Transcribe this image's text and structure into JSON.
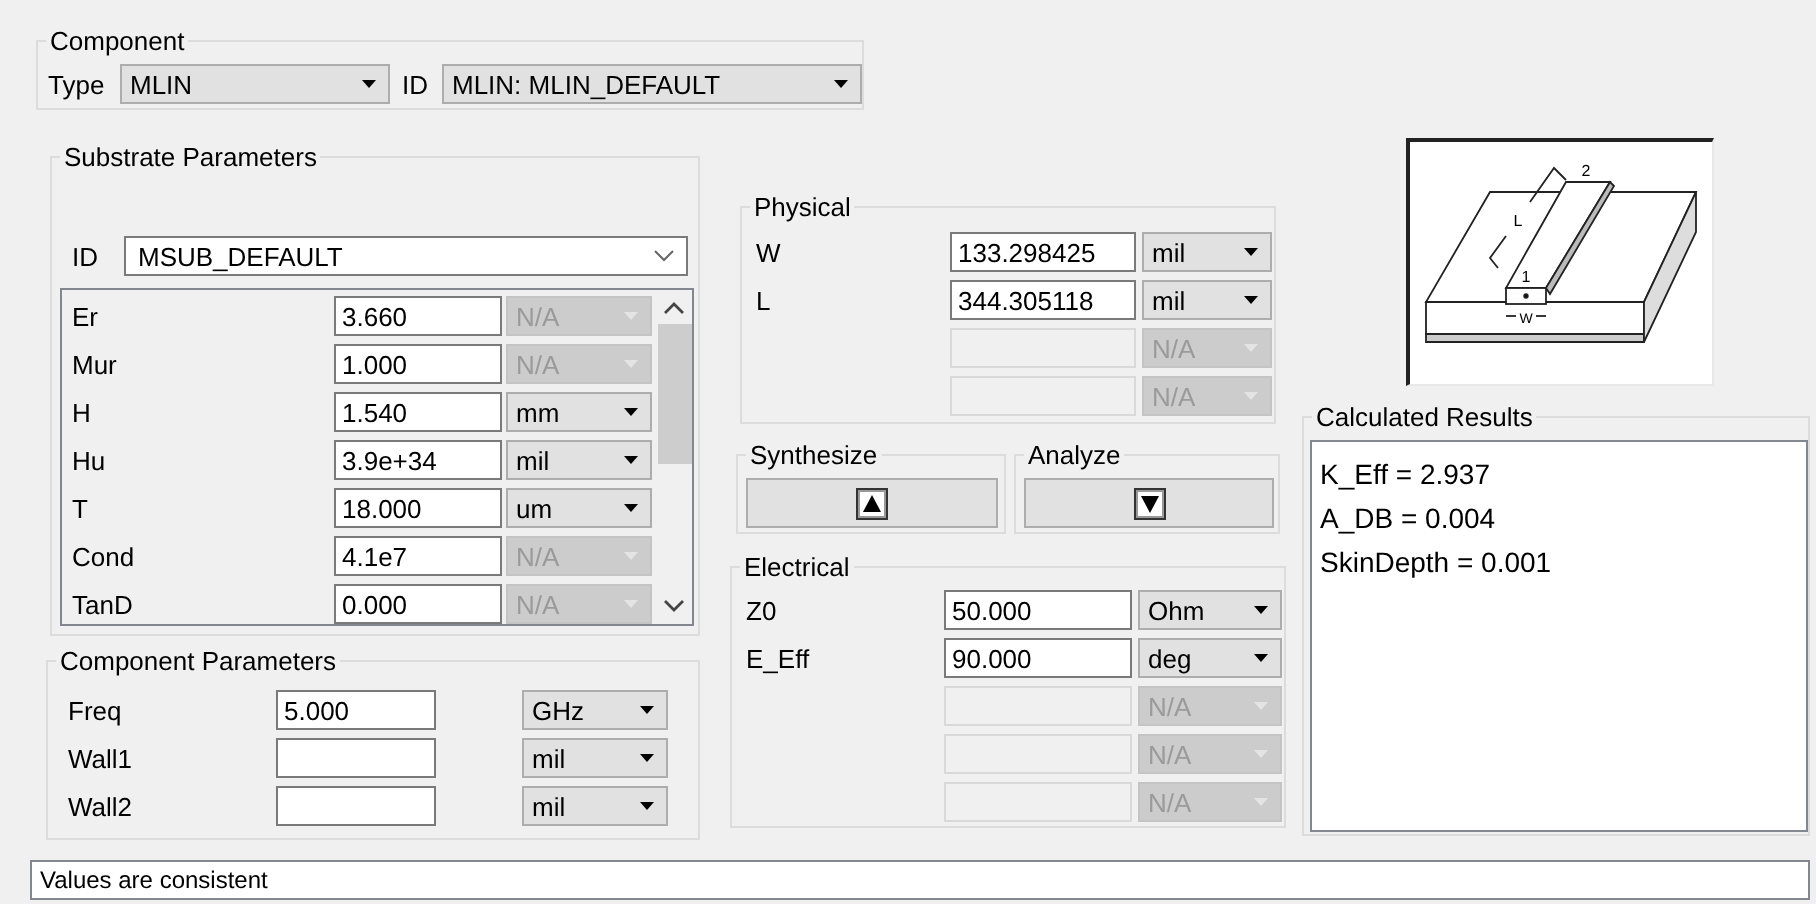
{
  "component": {
    "title": "Component",
    "type_label": "Type",
    "type_value": "MLIN",
    "id_label": "ID",
    "id_value": "MLIN: MLIN_DEFAULT"
  },
  "substrate": {
    "title": "Substrate Parameters",
    "id_label": "ID",
    "id_value": "MSUB_DEFAULT",
    "params": [
      {
        "name": "Er",
        "value": "3.660",
        "unit": {
          "label": "N/A",
          "disabled": true
        }
      },
      {
        "name": "Mur",
        "value": "1.000",
        "unit": {
          "label": "N/A",
          "disabled": true
        }
      },
      {
        "name": "H",
        "value": "1.540",
        "unit": {
          "label": "mm",
          "disabled": false
        }
      },
      {
        "name": "Hu",
        "value": "3.9e+34",
        "unit": {
          "label": "mil",
          "disabled": false
        }
      },
      {
        "name": "T",
        "value": "18.000",
        "unit": {
          "label": "um",
          "disabled": false
        }
      },
      {
        "name": "Cond",
        "value": "4.1e7",
        "unit": {
          "label": "N/A",
          "disabled": true
        }
      },
      {
        "name": "TanD",
        "value": "0.000",
        "unit": {
          "label": "N/A",
          "disabled": true
        }
      }
    ]
  },
  "component_parameters": {
    "title": "Component Parameters",
    "params": [
      {
        "name": "Freq",
        "value": "5.000",
        "field_disabled": false,
        "unit": {
          "label": "GHz",
          "disabled": false
        }
      },
      {
        "name": "Wall1",
        "field_disabled": false,
        "unit": {
          "label": "mil",
          "disabled": false
        }
      },
      {
        "name": "Wall2",
        "field_disabled": false,
        "unit": {
          "label": "mil",
          "disabled": false
        }
      }
    ]
  },
  "physical": {
    "title": "Physical",
    "rows": [
      {
        "name": "W",
        "value": "133.298425",
        "field_disabled": false,
        "unit": {
          "label": "mil",
          "disabled": false
        }
      },
      {
        "name": "L",
        "value": "344.305118",
        "field_disabled": false,
        "unit": {
          "label": "mil",
          "disabled": false
        }
      },
      {
        "field_disabled": true,
        "unit": {
          "label": "N/A",
          "disabled": true
        }
      },
      {
        "field_disabled": true,
        "unit": {
          "label": "N/A",
          "disabled": true
        }
      }
    ]
  },
  "actions": [
    {
      "title": "Synthesize",
      "kind": "up"
    },
    {
      "title": "Analyze",
      "kind": "down"
    }
  ],
  "electrical": {
    "title": "Electrical",
    "rows": [
      {
        "name": "Z0",
        "value": "50.000",
        "field_disabled": false,
        "unit": {
          "label": "Ohm",
          "disabled": false
        }
      },
      {
        "name": "E_Eff",
        "value": "90.000",
        "field_disabled": false,
        "unit": {
          "label": "deg",
          "disabled": false
        }
      },
      {
        "field_disabled": true,
        "unit": {
          "label": "N/A",
          "disabled": true
        }
      },
      {
        "field_disabled": true,
        "unit": {
          "label": "N/A",
          "disabled": true
        }
      },
      {
        "field_disabled": true,
        "unit": {
          "label": "N/A",
          "disabled": true
        }
      }
    ]
  },
  "diagram": {
    "labels": [
      "2",
      "L",
      "1",
      "W"
    ]
  },
  "results": {
    "title": "Calculated Results",
    "lines": [
      "K_Eff = 2.937",
      "A_DB = 0.004",
      "SkinDepth = 0.001"
    ]
  },
  "status_bar": "Values are consistent"
}
